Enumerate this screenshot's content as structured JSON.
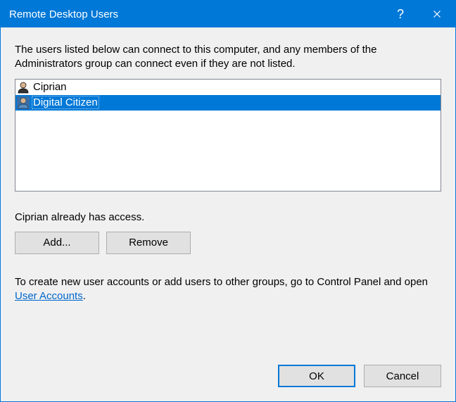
{
  "titlebar": {
    "title": "Remote Desktop Users"
  },
  "content": {
    "description": "The users listed below can connect to this computer, and any members of the Administrators group can connect even if they are not listed.",
    "users": [
      {
        "name": "Ciprian",
        "selected": false
      },
      {
        "name": "Digital Citizen",
        "selected": true
      }
    ],
    "access_note": "Ciprian already has access.",
    "add_label": "Add...",
    "remove_label": "Remove",
    "help_prefix": "To create new user accounts or add users to other groups, go to Control Panel and open ",
    "help_link": "User Accounts",
    "help_suffix": "."
  },
  "footer": {
    "ok_label": "OK",
    "cancel_label": "Cancel"
  }
}
